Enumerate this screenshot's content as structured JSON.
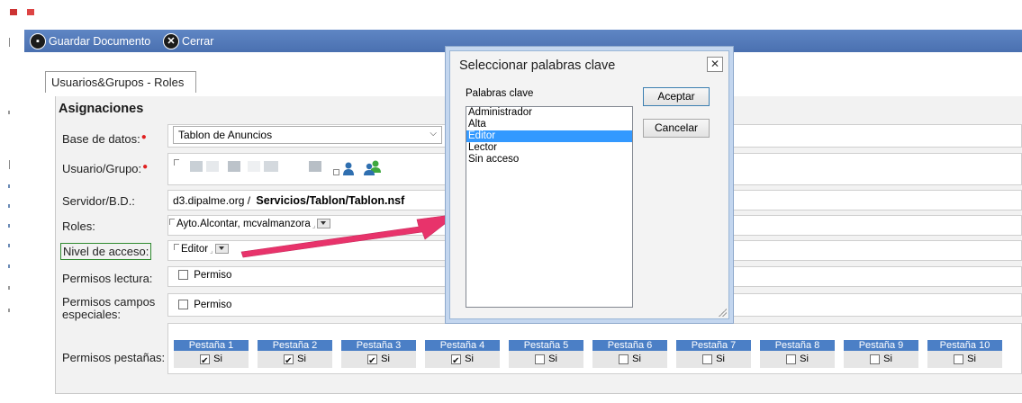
{
  "toolbar": {
    "save": "Guardar Documento",
    "close": "Cerrar"
  },
  "tab": {
    "label": "Usuarios&Grupos - Roles"
  },
  "section": {
    "title": "Asignaciones"
  },
  "fields": {
    "database": {
      "label": "Base de datos:",
      "value": "Tablon de Anuncios"
    },
    "user": {
      "label": "Usuario/Grupo:"
    },
    "server": {
      "label": "Servidor/B.D.:",
      "server": "d3.dipalme.org /",
      "path": "Servicios/Tablon/Tablon.nsf"
    },
    "roles": {
      "label": "Roles:",
      "value": "Ayto.Alcontar, mcvalmanzora"
    },
    "access": {
      "label": "Nivel de acceso:",
      "value": "Editor"
    },
    "read": {
      "label": "Permisos lectura:",
      "check": "Permiso"
    },
    "special": {
      "label": "Permisos campos especiales:",
      "check": "Permiso"
    },
    "tabs": {
      "label": "Permisos pestañas:"
    }
  },
  "tab_permissions": [
    {
      "name": "Pestaña 1",
      "label": "Si",
      "checked": true
    },
    {
      "name": "Pestaña 2",
      "label": "Si",
      "checked": true
    },
    {
      "name": "Pestaña 3",
      "label": "Si",
      "checked": true
    },
    {
      "name": "Pestaña 4",
      "label": "Si",
      "checked": true
    },
    {
      "name": "Pestaña 5",
      "label": "Si",
      "checked": false
    },
    {
      "name": "Pestaña 6",
      "label": "Si",
      "checked": false
    },
    {
      "name": "Pestaña 7",
      "label": "Si",
      "checked": false
    },
    {
      "name": "Pestaña 8",
      "label": "Si",
      "checked": false
    },
    {
      "name": "Pestaña 9",
      "label": "Si",
      "checked": false
    },
    {
      "name": "Pestaña 10",
      "label": "Si",
      "checked": false
    }
  ],
  "dialog": {
    "title": "Seleccionar palabras clave",
    "list_label": "Palabras clave",
    "items": [
      "Administrador",
      "Alta",
      "Editor",
      "Lector",
      "Sin acceso"
    ],
    "selected": "Editor",
    "accept": "Aceptar",
    "cancel": "Cancelar"
  },
  "colors": {
    "toolbar": "#4f76b6",
    "tab_header": "#4b7fc6",
    "arrow": "#e8336b",
    "selection": "#3399ff"
  }
}
